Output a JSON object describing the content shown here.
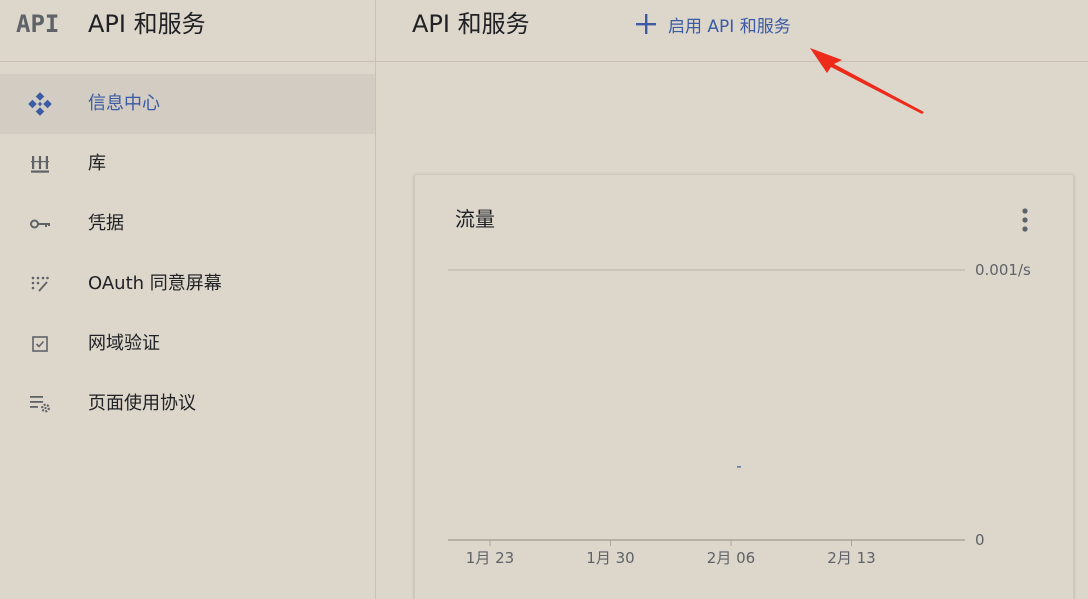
{
  "sidebar": {
    "logo": "API",
    "title": "API 和服务",
    "items": [
      {
        "label": "信息中心",
        "icon": "dashboard-icon",
        "active": true
      },
      {
        "label": "库",
        "icon": "library-icon",
        "active": false
      },
      {
        "label": "凭据",
        "icon": "key-icon",
        "active": false
      },
      {
        "label": "OAuth 同意屏幕",
        "icon": "consent-icon",
        "active": false
      },
      {
        "label": "网域验证",
        "icon": "checkbox-icon",
        "active": false
      },
      {
        "label": "页面使用协议",
        "icon": "settings-list-icon",
        "active": false
      }
    ]
  },
  "header": {
    "title": "API 和服务",
    "enable_button": "启用 API 和服务"
  },
  "card": {
    "title": "流量"
  },
  "chart_data": {
    "type": "line",
    "title": "流量",
    "x_ticks": [
      "1月 23",
      "1月 30",
      "2月 06",
      "2月 13"
    ],
    "y_ticks": [
      "0",
      "0.001/s"
    ],
    "ylim": [
      0,
      0.001
    ],
    "series": [],
    "no_data_text": "-",
    "grid": true
  },
  "colors": {
    "accent": "#3b5ba5",
    "annotation_arrow": "#ee2a1b",
    "background": "#dcd6cb"
  }
}
